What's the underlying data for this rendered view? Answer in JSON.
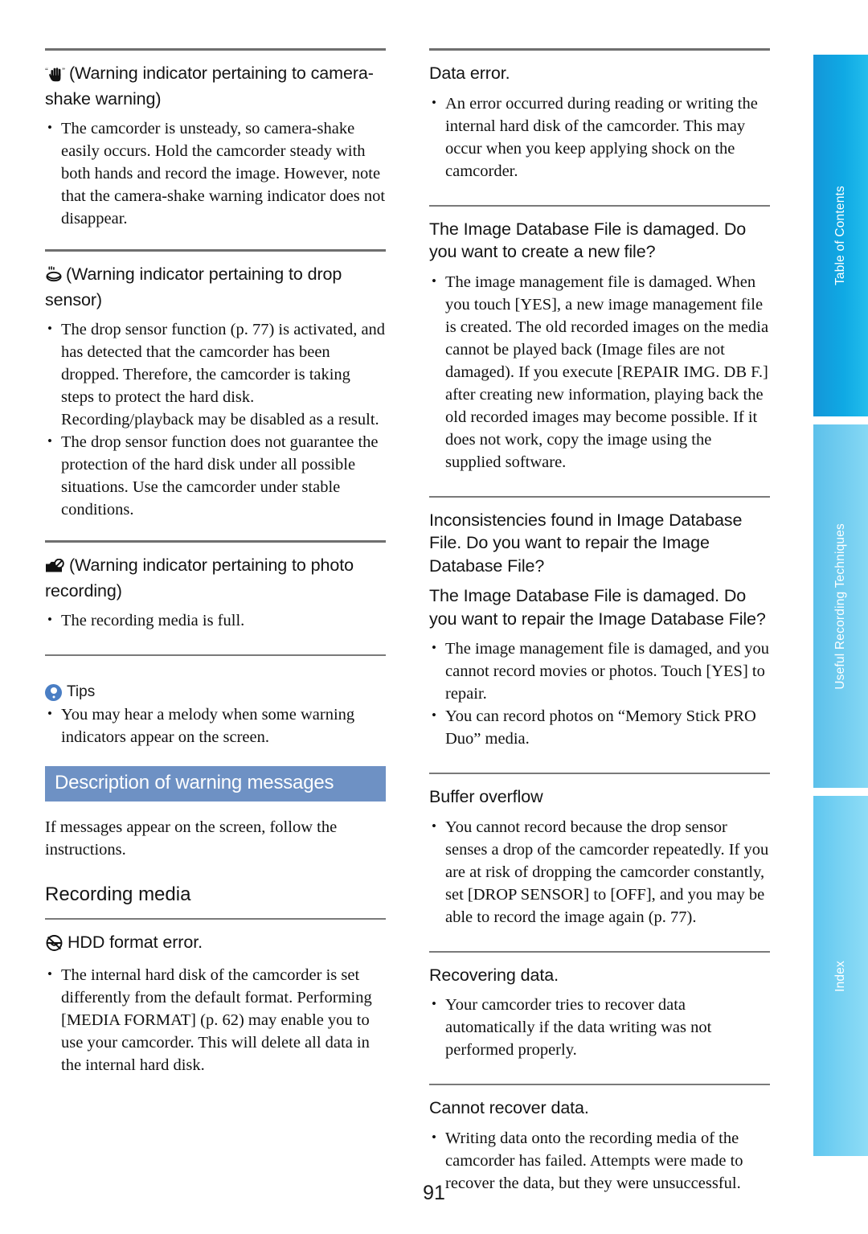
{
  "page": {
    "folio": "91"
  },
  "tabs": [
    {
      "label": "Table of Contents",
      "color": "#0fa9e4"
    },
    {
      "label": "Useful Recording Techniques",
      "color": "#72cdf0"
    },
    {
      "label": "Index",
      "color": "#7ad3f3"
    }
  ],
  "section_banner": {
    "label": "Description of warning messages",
    "bg_color": "#6e91c4",
    "text_color": "#ffffff"
  },
  "left_column": {
    "entries": [
      {
        "icon": "camera-shake-hand-icon",
        "heading": "“🖐” (Warning indicator pertaining to camera-shake warning)",
        "heading_text": "(Warning indicator pertaining to camera-shake warning)",
        "bullets": [
          "The camcorder is unsteady, so camera-shake easily occurs. Hold the camcorder steady with both hands and record the image. However, note that the camera-shake warning indicator does not disappear."
        ]
      },
      {
        "icon": "drop-sensor-icon",
        "heading_text": "(Warning indicator pertaining to drop sensor)",
        "bullets": [
          "The drop sensor function (p. 77) is activated, and has detected that the camcorder has been dropped. Therefore, the camcorder is taking steps to protect the hard disk. Recording/playback may be disabled as a result.",
          "The drop sensor function does not guarantee the protection of the hard disk under all possible situations. Use the camcorder under stable conditions."
        ]
      },
      {
        "icon": "photo-recording-prohibited-icon",
        "heading_text": "(Warning indicator pertaining to photo recording)",
        "bullets": [
          "The recording media is full."
        ]
      }
    ],
    "tips": {
      "icon": "lightbulb-tips-icon",
      "label": "Tips",
      "bullets": [
        "You may hear a melody when some warning indicators appear on the screen."
      ]
    },
    "intro_paragraph": "If messages appear on the screen, follow the instructions.",
    "subsection_title": "Recording media",
    "messages": [
      {
        "icon": "hdd-format-error-icon",
        "title": "HDD format error.",
        "bullets": [
          "The internal hard disk of the camcorder is set differently from the default format. Performing [MEDIA FORMAT] (p. 62) may enable you to use your camcorder. This will delete all data in the internal hard disk."
        ]
      }
    ]
  },
  "right_column": {
    "messages": [
      {
        "title": "Data error.",
        "bullets": [
          "An error occurred during reading or writing the internal hard disk of the camcorder. This may occur when you keep applying shock on the camcorder."
        ]
      },
      {
        "title": "The Image Database File is damaged. Do you want to create a new file?",
        "bullets": [
          "The image management file is damaged. When you touch [YES], a new image management file is created. The old recorded images on the media cannot be played back (Image files are not damaged). If you execute [REPAIR IMG. DB F.] after creating new information, playing back the old recorded images may become possible. If it does not work, copy the image using the supplied software."
        ]
      },
      {
        "title": "Inconsistencies found in Image Database File. Do you want to repair the Image Database File?",
        "title2": "The Image Database File is damaged. Do you want to repair the Image Database File?",
        "bullets": [
          "The image management file is damaged, and you cannot record movies or photos. Touch [YES] to repair.",
          "You can record photos on “Memory Stick PRO Duo” media."
        ]
      },
      {
        "title": "Buffer overflow",
        "bullets": [
          "You cannot record because the drop sensor senses a drop of the camcorder repeatedly. If you are at risk of dropping the camcorder constantly, set [DROP SENSOR] to [OFF], and you may be able to record the image again (p. 77)."
        ]
      },
      {
        "title": "Recovering data.",
        "bullets": [
          "Your camcorder tries to recover data automatically if the data writing was not performed properly."
        ]
      },
      {
        "title": "Cannot recover data.",
        "bullets": [
          "Writing data onto the recording media of the camcorder has failed. Attempts were made to recover the data, but they were unsuccessful."
        ]
      }
    ]
  }
}
